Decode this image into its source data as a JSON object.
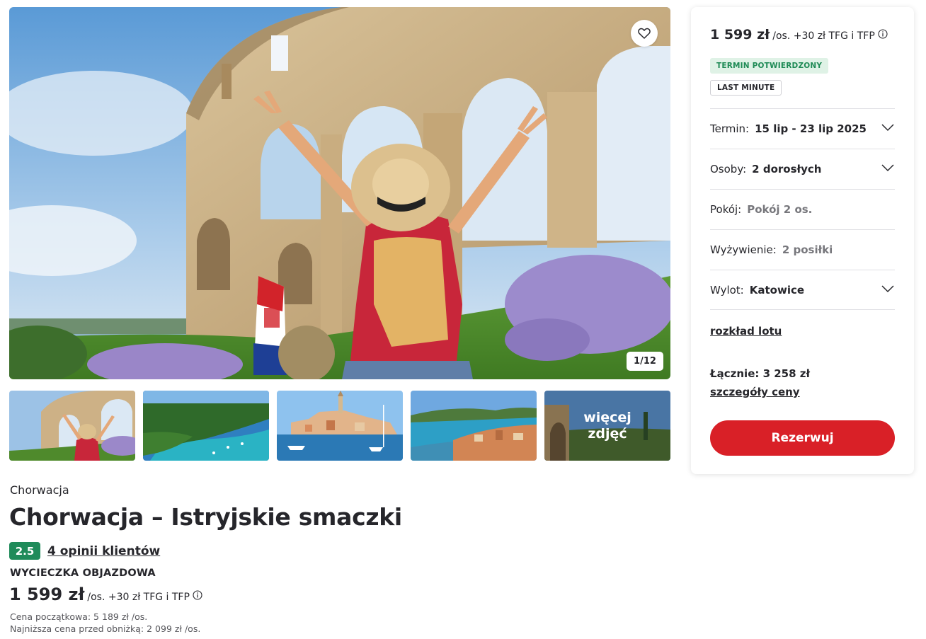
{
  "gallery": {
    "counter": "1/12",
    "more_photos_label": "więcej zdjęć",
    "favorite_icon": "heart-icon"
  },
  "offer": {
    "country": "Chorwacja",
    "title": "Chorwacja – Istryjskie smaczki",
    "rating": "2.5",
    "reviews_link": "4 opinii klientów",
    "trip_type": "WYCIECZKA OBJAZDOWA",
    "price": "1 599 zł",
    "price_suffix": "/os. +30 zł TFG i TFP",
    "initial_price": "Cena początkowa: 5 189 zł /os.",
    "lowest_price": "Najniższa cena przed obniżką: 2 099 zł /os."
  },
  "booking": {
    "price": "1 599 zł",
    "price_suffix": "/os. +30 zł TFG i TFP",
    "tag_confirmed": "TERMIN POTWIERDZONY",
    "tag_last_minute": "LAST MINUTE",
    "rows": [
      {
        "label": "Termin:",
        "value": "15 lip - 23 lip 2025"
      },
      {
        "label": "Osoby:",
        "value": "2 dorosłych"
      },
      {
        "label": "Pokój:",
        "value": "Pokój 2 os."
      },
      {
        "label": "Wyżywienie:",
        "value": "2 posiłki"
      },
      {
        "label": "Wylot:",
        "value": "Katowice"
      }
    ],
    "flight_link": "rozkład lotu",
    "total": "Łącznie: 3 258 zł",
    "price_details_link": "szczegóły ceny",
    "book_button": "Rezerwuj"
  },
  "colors": {
    "accent_red": "#d92027",
    "rating_green": "#1f8b5a",
    "tag_green_bg": "#dff2e6",
    "tag_green_text": "#1e8a55"
  }
}
